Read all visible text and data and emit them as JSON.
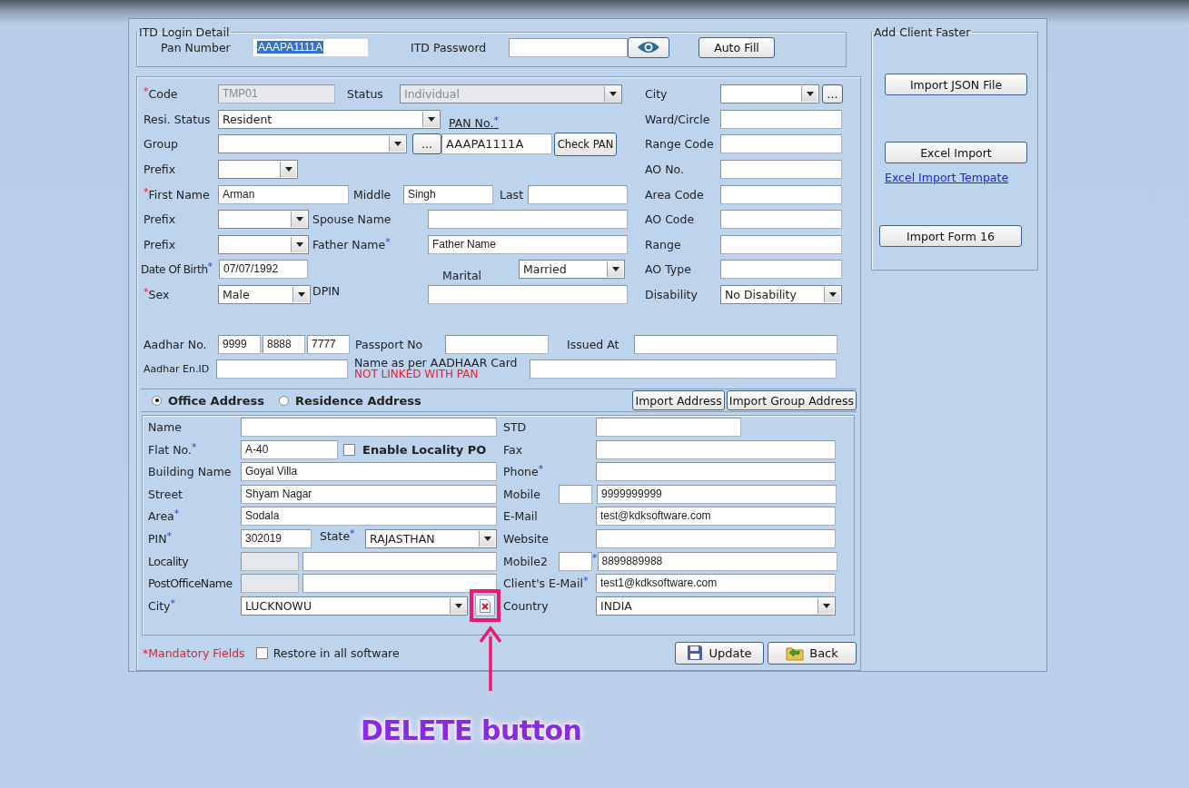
{
  "login": {
    "legend": "ITD Login Detail",
    "pan_label": "Pan Number",
    "pan_value": "AAAPA1111A",
    "pan_value_selected": true,
    "password_label": "ITD Password",
    "auto_fill": "Auto Fill"
  },
  "personal": {
    "code": {
      "label": "Code",
      "star": {
        "text": "*",
        "kind": "leading"
      },
      "value": "TMP01",
      "disabled": true
    },
    "status": {
      "label": "Status",
      "value": "Individual",
      "disabled": true
    },
    "resi_status": {
      "label": "Resi. Status",
      "value": "Resident"
    },
    "pan_no": {
      "label": "PAN No.",
      "star": {
        "text": "*",
        "kind": "trailing"
      },
      "value": "AAAPA1111A"
    },
    "group": {
      "label": "Group",
      "browse": "..."
    },
    "check_pan": "Check PAN",
    "prefix_1": {
      "label": "Prefix"
    },
    "first_name": {
      "label": "First Name",
      "star": {
        "text": "*",
        "kind": "leading"
      },
      "value": "Arman"
    },
    "middle": {
      "label": "Middle",
      "value": "Singh"
    },
    "last": {
      "label": "Last"
    },
    "prefix_2": {
      "label": "Prefix"
    },
    "spouse_name": {
      "label": "Spouse Name"
    },
    "prefix_3": {
      "label": "Prefix"
    },
    "father_name": {
      "label": "Father Name",
      "star": {
        "text": "*",
        "kind": "trailing"
      },
      "value": "Father Name"
    },
    "date_of_birth": {
      "label": "Date Of Birth",
      "star": {
        "text": "*",
        "kind": "trailing"
      },
      "value": "07/07/1992"
    },
    "marital": {
      "label": "Marital",
      "value": "Married"
    },
    "sex": {
      "label": "Sex",
      "star": {
        "text": "*",
        "kind": "leading"
      },
      "value": "Male"
    },
    "dpin": {
      "label": "DPIN"
    }
  },
  "office": [
    {
      "kind": "select",
      "label": "City",
      "browse": "..."
    },
    {
      "kind": "text",
      "label": "Ward/Circle"
    },
    {
      "kind": "text",
      "label": "Range Code"
    },
    {
      "kind": "text",
      "label": "AO No."
    },
    {
      "kind": "text",
      "label": "Area Code"
    },
    {
      "kind": "text",
      "label": "AO Code"
    },
    {
      "kind": "text",
      "label": "Range"
    },
    {
      "kind": "text",
      "label": "AO Type"
    },
    {
      "kind": "select",
      "label": "Disability",
      "value": "No Disability"
    }
  ],
  "aadhar": {
    "label": "Aadhar No.",
    "parts": [
      "9999",
      "8888",
      "7777"
    ],
    "passport_label": "Passport No",
    "issued_at_label": "Issued At",
    "enrolment_label": "Aadhar En.ID",
    "name_label": "Name as per AADHAAR Card",
    "link_status": "NOT LINKED WITH PAN"
  },
  "address_type": [
    {
      "label": "Office Address",
      "selected": true
    },
    {
      "label": "Residence Address",
      "selected": false
    }
  ],
  "address_buttons": [
    "Import Address",
    "Import Group Address"
  ],
  "address": {
    "left": [
      {
        "kind": "text",
        "label": "Name"
      },
      {
        "kind": "with_checkbox",
        "label": "Flat No.",
        "star": {
          "text": "*",
          "kind": "trailing"
        },
        "value": "A-40",
        "checkbox": {
          "label": "Enable Locality PO",
          "checked": false
        }
      },
      {
        "kind": "text",
        "label": "Building Name",
        "value": "Goyal Villa"
      },
      {
        "kind": "text",
        "label": "Street",
        "value": "Shyam Nagar"
      },
      {
        "kind": "text",
        "label": "Area",
        "star": {
          "text": "*",
          "kind": "trailing"
        },
        "value": "Sodala"
      },
      {
        "kind": "with_select",
        "label": "PIN",
        "star": {
          "text": "*",
          "kind": "trailing"
        },
        "value": "302019",
        "select": {
          "label": "State",
          "star": {
            "text": "*",
            "kind": "trailing"
          },
          "value": "RAJASTHAN"
        }
      },
      {
        "kind": "split",
        "label": "Locality"
      },
      {
        "kind": "split",
        "label": "PostOfficeName"
      },
      {
        "kind": "select_delete",
        "label": "City",
        "star": {
          "text": "*",
          "kind": "trailing"
        },
        "value": "LUCKNOWU"
      }
    ],
    "right": [
      {
        "kind": "short",
        "label": "STD"
      },
      {
        "kind": "text",
        "label": "Fax"
      },
      {
        "kind": "text",
        "label": "Phone",
        "star": {
          "text": "*",
          "kind": "trailing"
        }
      },
      {
        "kind": "mobile",
        "label": "Mobile",
        "value": "9999999999"
      },
      {
        "kind": "text",
        "label": "E-Mail",
        "value": "test@kdksoftware.com"
      },
      {
        "kind": "text",
        "label": "Website"
      },
      {
        "kind": "mobile",
        "label": "Mobile2",
        "star": "*",
        "value": "8899889988"
      },
      {
        "kind": "text",
        "label": "Client's E-Mail",
        "star": {
          "text": "*",
          "kind": "trailing"
        },
        "value": "test1@kdksoftware.com"
      },
      {
        "kind": "select",
        "label": "Country",
        "value": "INDIA"
      }
    ]
  },
  "footer": {
    "mandatory_note": "*Mandatory Fields",
    "restore": {
      "label": "Restore in all software",
      "checked": false
    },
    "buttons": [
      {
        "kind": "save",
        "label": "Update"
      },
      {
        "kind": "back",
        "label": "Back"
      }
    ]
  },
  "side": {
    "legend": "Add Client Faster",
    "items": [
      {
        "kind": "button",
        "label": "Import JSON File"
      },
      {
        "kind": "button",
        "label": "Excel Import"
      },
      {
        "kind": "link",
        "label": "Excel Import Tempate"
      },
      {
        "kind": "button",
        "label": "Import Form 16"
      }
    ]
  },
  "annotation": {
    "text": "DELETE button"
  }
}
